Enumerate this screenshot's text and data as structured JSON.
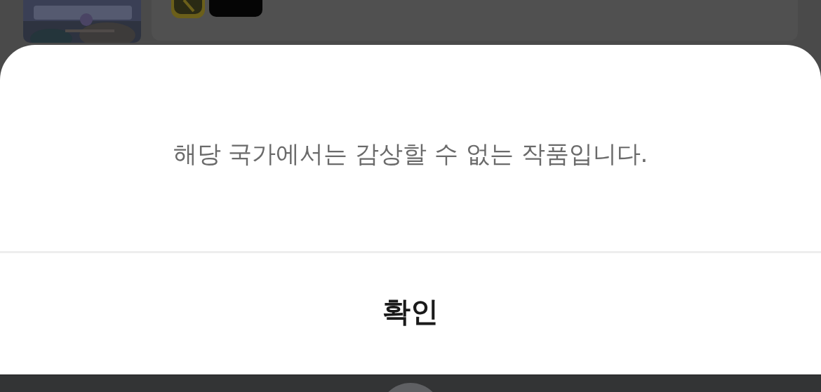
{
  "dialog": {
    "message": "해당 국가에서는 감상할 수 없는 작품입니다.",
    "confirm_button": "확인"
  }
}
